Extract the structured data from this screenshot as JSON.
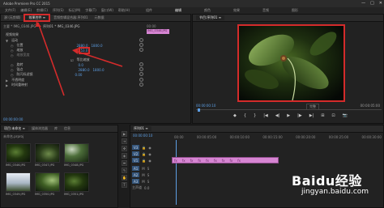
{
  "app": {
    "title": "Adobe Premiere Pro CC 2015",
    "window_controls": [
      "—",
      "□",
      "✕"
    ]
  },
  "menu": {
    "items": [
      "文件(F)",
      "编辑(E)",
      "剪辑(C)",
      "序列(S)",
      "标记(M)",
      "字幕(T)",
      "窗口(W)",
      "帮助(H)"
    ],
    "workspaces": [
      "组件",
      "编辑",
      "颜色",
      "效果",
      "音频",
      "图形"
    ]
  },
  "effect_controls": {
    "tabs": [
      "源:(无剪辑)",
      "效果控件 ≡",
      "音频剪辑混合器:序列01",
      "元数据"
    ],
    "active_tab": 1,
    "source_line": "主要 * IMG_0346.JPG",
    "sequence_line": "序列01 * IMG_0346.JPG",
    "clip_label": "IMG_0346.JPG",
    "timecode_small": "00:00",
    "sections": {
      "video": "视频效果",
      "motion": "运动",
      "position": "位置",
      "scale": "缩放",
      "scale_value": "53.0",
      "scale_width": "缩放宽度",
      "uniform_scale": "等比缩放",
      "rotation": "旋转",
      "anchor": "锚点",
      "anti_flicker": "防闪烁滤镜",
      "opacity": "不透明度",
      "time_remap": "时间重映射"
    },
    "values": {
      "position_x": "2880.0",
      "position_y": "1800.0",
      "rotation": "0.0",
      "anchor_x": "2880.0",
      "anchor_y": "1800.0",
      "anti_flicker": "0.00"
    },
    "timecode": "00:00:00:00"
  },
  "program": {
    "tab": "节目:序列01 ≡",
    "timecode_left": "00:00:00:10",
    "fit": "完整",
    "timecode_right": "00:00:05:00",
    "controls": [
      "◆",
      "{",
      "}",
      "|◀",
      "◀|",
      "▶",
      "|▶",
      "▶|",
      "⊞",
      "⊡",
      "📷"
    ]
  },
  "project": {
    "tabs": [
      "项目:未命名 ≡",
      "媒体浏览器",
      "库",
      "信息"
    ],
    "path": "未命名.prproj",
    "items": [
      {
        "label": "IMG_0346.JPG",
        "dur": "5:00"
      },
      {
        "label": "IMG_0347.JPG",
        "dur": "5:00"
      },
      {
        "label": "IMG_0348.JPG",
        "dur": "5:00"
      },
      {
        "label": "IMG_0349.JPG",
        "dur": "5:00"
      },
      {
        "label": "IMG_0350.JPG",
        "dur": "5:00"
      },
      {
        "label": "IMG_0351.JPG",
        "dur": "5:00"
      }
    ]
  },
  "timeline": {
    "tab": "序列01 ≡",
    "timecode": "00:00:00:10",
    "ruler": [
      "00:00",
      "00:00:05:00",
      "00:00:10:00",
      "00:00:15:00",
      "00:00:20:00",
      "00:00:25:00",
      "00:00:30:00",
      "00:00:35:00"
    ],
    "tracks": [
      "V3",
      "V2",
      "V1",
      "A1",
      "A2",
      "A3",
      "主声道"
    ],
    "master_value": "0.0",
    "clip_label": "fx"
  },
  "tools": [
    "▶",
    "⇥",
    "✥",
    "◈",
    "⬌",
    "✎",
    "✋",
    "T"
  ],
  "watermark": {
    "brand": "Baidu经验",
    "url": "jingyan.baidu.com"
  },
  "colors": {
    "highlight_red": "#d42b2b",
    "clip_pink": "#d685d2",
    "accent_blue": "#5d9ee3"
  }
}
